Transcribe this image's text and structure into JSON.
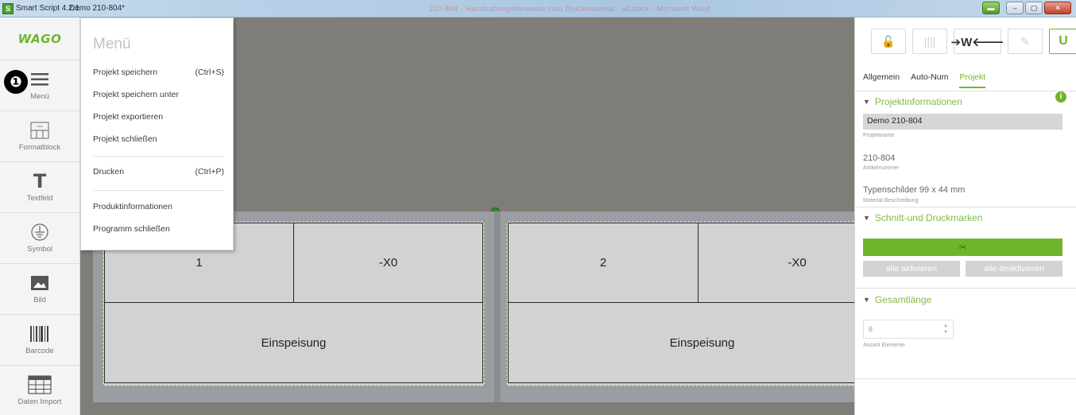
{
  "window": {
    "app_title": "Smart Script 4.2.1",
    "document_title": "Demo 210-804*",
    "background_window_title": "210-804 · Handhabungshinweise zum Druckmaterial · all.docx · Microsoft Word",
    "controls": {
      "extra": "▬",
      "minimize": "–",
      "maximize": "▢",
      "close": "✕"
    }
  },
  "brand": {
    "logo": "WAGO",
    "accent_color": "#6fb52c"
  },
  "annotation_marker": "❶",
  "left_toolbar": {
    "items": [
      {
        "label": "Menü",
        "icon": "hamburger-icon"
      },
      {
        "label": "Formatblock",
        "icon": "format-block-icon"
      },
      {
        "label": "Textfeld",
        "icon": "text-icon",
        "glyph": "T"
      },
      {
        "label": "Symbol",
        "icon": "ground-symbol-icon"
      },
      {
        "label": "Bild",
        "icon": "image-icon"
      },
      {
        "label": "Barcode",
        "icon": "barcode-icon"
      },
      {
        "label": "Daten Import",
        "icon": "table-import-icon"
      }
    ]
  },
  "menu": {
    "title": "Menü",
    "items": [
      {
        "label": "Projekt speichern",
        "shortcut": "(Ctrl+S)"
      },
      {
        "label": "Projekt speichern unter",
        "shortcut": ""
      },
      {
        "label": "Projekt exportieren",
        "shortcut": ""
      },
      {
        "label": "Projekt schließen",
        "shortcut": ""
      },
      {
        "label": "Drucken",
        "shortcut": "(Ctrl+P)"
      },
      {
        "label": "Produktinformationen",
        "shortcut": ""
      },
      {
        "label": "Programm schließen",
        "shortcut": ""
      }
    ]
  },
  "labels": [
    {
      "number": "1",
      "code": "-X0",
      "text": "Einspeisung"
    },
    {
      "number": "2",
      "code": "-X0",
      "text": "Einspeisung"
    }
  ],
  "right_panel": {
    "toolbar": {
      "lock": "🔓",
      "columns": "||||",
      "direction": "➔W🡐",
      "wand": "✎",
      "magnet": "U"
    },
    "tabs": [
      "Allgemein",
      "Auto-Num",
      "Projekt"
    ],
    "active_tab": "Projekt",
    "sections": {
      "projektinformationen": {
        "title": "Projektinformationen",
        "project_name": "Demo 210-804",
        "project_name_caption": "Projektname",
        "article_number": "210-804",
        "article_number_caption": "Artikelnummer",
        "material": "Typenschilder  99 x 44 mm",
        "material_caption": "Material Beschreibung"
      },
      "schnitt": {
        "title": "Schnitt-und Druckmarken",
        "cut_symbol": "✂",
        "activate_all": "alle aktivieren",
        "deactivate_all": "alle deaktivieren"
      },
      "gesamtlaenge": {
        "title": "Gesamtlänge",
        "count_value": "6",
        "count_caption": "Anzahl Elemente"
      }
    },
    "info_symbol": "i"
  }
}
